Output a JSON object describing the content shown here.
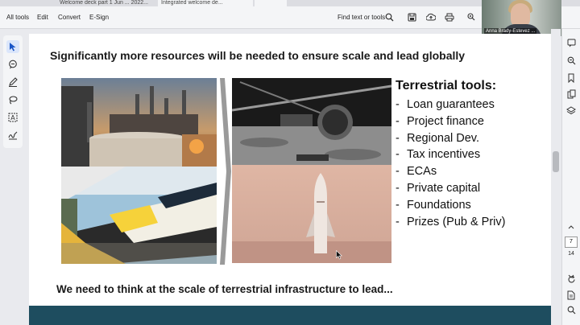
{
  "tabs": [
    {
      "label": "Welcome deck part 1 Jun ... 2022...",
      "active": false
    },
    {
      "label": "Integrated welcome de...",
      "active": true
    }
  ],
  "toolbar": {
    "all_tools": "All tools",
    "edit": "Edit",
    "convert": "Convert",
    "esign": "E-Sign",
    "find_text": "Find text or tools"
  },
  "video": {
    "participant_name": "Anna Brady-Estevez ..."
  },
  "slide": {
    "title": "Significantly more resources will be needed to ensure scale and lead globally",
    "terrestrial_heading": "Terrestrial tools:",
    "tools": [
      "Loan guarantees",
      "Project finance",
      "Regional Dev.",
      "Tax incentives",
      "ECAs",
      "Private capital",
      "Foundations",
      "Prizes (Pub & Priv)"
    ],
    "bottom_text": "We need to think at the scale of terrestrial infrastructure to lead..."
  },
  "right_panel": {
    "current_page": "7",
    "total_pages": "14"
  },
  "colors": {
    "accent": "#1e4d5f",
    "select_tool_bg": "#dbe6fb",
    "toolbar_bg": "#f4f5f7"
  },
  "icons": [
    "search-icon",
    "save-icon",
    "upload-icon",
    "print-icon",
    "share-icon",
    "cursor-icon",
    "comment-icon",
    "pen-icon",
    "lasso-icon",
    "text-select-icon",
    "sign-icon"
  ]
}
